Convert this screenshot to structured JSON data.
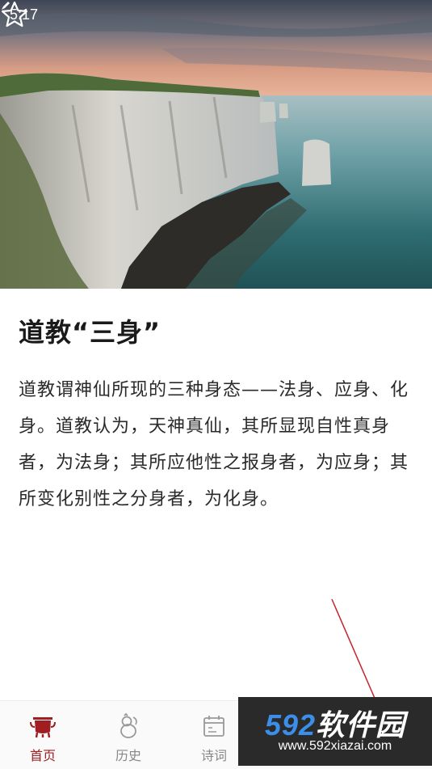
{
  "status_bar": {
    "time": "5:17",
    "notification_icon": "pen-icon"
  },
  "hero": {
    "image_description_icon": "seascape-cliff-image",
    "favorite_icon": "star-outline-icon"
  },
  "article": {
    "title": "道教“三身”",
    "body": "道教谓神仙所现的三种身态——法身、应身、化身。道教认为，天神真仙，其所显现自性真身者，为法身；其所应他性之报身者，为应身；其所变化别性之分身者，为化身。"
  },
  "bottom_nav": {
    "items": [
      {
        "label": "首页",
        "icon": "cauldron-icon",
        "active": true
      },
      {
        "label": "历史",
        "icon": "gourd-icon",
        "active": false
      },
      {
        "label": "诗词",
        "icon": "calendar-icon",
        "active": false
      }
    ]
  },
  "watermark": {
    "brand_num": "592",
    "brand_cn": "软件园",
    "url": "www.592xiazai.com"
  },
  "colors": {
    "accent": "#a01d22",
    "inactive": "#888888",
    "watermark_blue": "#3b8fe8"
  }
}
